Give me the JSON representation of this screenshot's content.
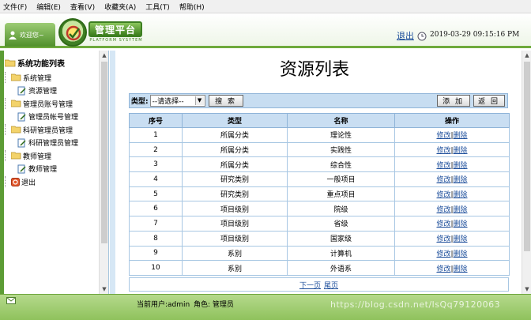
{
  "menubar": {
    "items": [
      "文件(F)",
      "编辑(E)",
      "查看(V)",
      "收藏夹(A)",
      "工具(T)",
      "帮助(H)"
    ]
  },
  "header": {
    "welcome": "欢迎您~",
    "logo_title": "管理平台",
    "logo_subtitle": "PLATFORM SYSYTEM",
    "logout": "退出",
    "datetime": "2019-03-29 09:15:16 PM"
  },
  "sidebar": {
    "root": "系统功能列表",
    "items": [
      {
        "label": "系统管理",
        "level": 1
      },
      {
        "label": "资源管理",
        "level": 2
      },
      {
        "label": "管理员账号管理",
        "level": 1
      },
      {
        "label": "管理员帐号管理",
        "level": 2
      },
      {
        "label": "科研管理员管理",
        "level": 1
      },
      {
        "label": "科研管理员管理",
        "level": 2
      },
      {
        "label": "教师管理",
        "level": 1
      },
      {
        "label": "教师管理",
        "level": 2
      },
      {
        "label": "退出",
        "level": 0
      }
    ]
  },
  "page": {
    "title": "资源列表"
  },
  "toolbar": {
    "type_label": "类型:",
    "select_value": "--请选择--",
    "search_label": "搜 索",
    "add_label": "添 加",
    "back_label": "返 回"
  },
  "table": {
    "headers": [
      "序号",
      "类型",
      "名称",
      "操作"
    ],
    "rows": [
      [
        "1",
        "所属分类",
        "理论性"
      ],
      [
        "2",
        "所属分类",
        "实践性"
      ],
      [
        "3",
        "所属分类",
        "综合性"
      ],
      [
        "4",
        "研究类别",
        "一般项目"
      ],
      [
        "5",
        "研究类别",
        "重点项目"
      ],
      [
        "6",
        "项目级别",
        "院级"
      ],
      [
        "7",
        "项目级别",
        "省级"
      ],
      [
        "8",
        "项目级别",
        "国家级"
      ],
      [
        "9",
        "系别",
        "计算机"
      ],
      [
        "10",
        "系别",
        "外语系"
      ]
    ],
    "edit_label": "修改",
    "delete_label": "删除",
    "separator": "|"
  },
  "pager": {
    "next": "下一页",
    "last": "尾页"
  },
  "footer": {
    "user": "当前用户:admin",
    "role": "角色: 管理员",
    "watermark": "https://blog.csdn.net/lsQq79120063"
  },
  "colors": {
    "brand_green": "#5c9c35",
    "table_header": "#c9def2",
    "link": "#1a4c9a"
  }
}
